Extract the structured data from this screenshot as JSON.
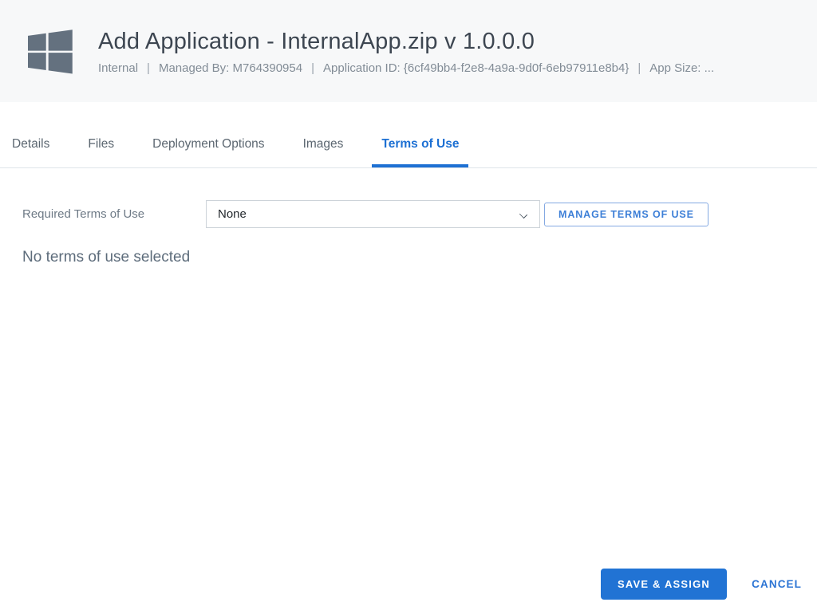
{
  "header": {
    "title": "Add Application - InternalApp.zip v 1.0.0.0",
    "meta": {
      "type": "Internal",
      "managed_by": "Managed By: M764390954",
      "application_id": "Application ID: {6cf49bb4-f2e8-4a9a-9d0f-6eb97911e8b4}",
      "app_size": "App Size: ...",
      "separator": "|"
    },
    "logo_icon": "windows-logo"
  },
  "tabs": [
    {
      "label": "Details",
      "active": false
    },
    {
      "label": "Files",
      "active": false
    },
    {
      "label": "Deployment Options",
      "active": false
    },
    {
      "label": "Images",
      "active": false
    },
    {
      "label": "Terms of Use",
      "active": true
    }
  ],
  "form": {
    "required_terms_label": "Required Terms of Use",
    "terms_select_value": "None",
    "manage_button_label": "MANAGE TERMS OF USE",
    "empty_state_text": "No terms of use selected"
  },
  "footer": {
    "save_button_label": "SAVE & ASSIGN",
    "cancel_button_label": "CANCEL"
  },
  "colors": {
    "accent_blue": "#1d70d3",
    "button_blue": "#2173d4",
    "header_background": "#f7f8f9",
    "logo_slate": "#64717f"
  }
}
